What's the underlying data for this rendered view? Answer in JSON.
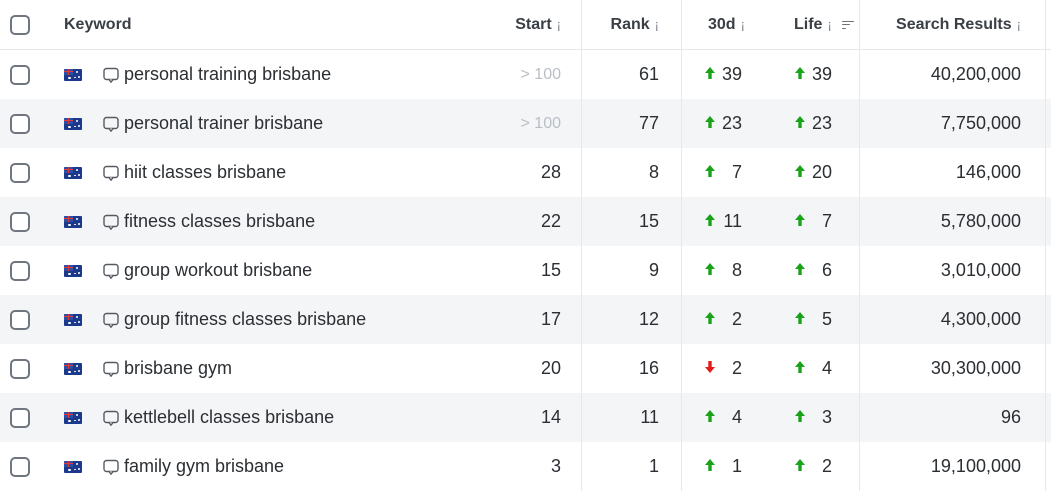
{
  "colors": {
    "up": "#1aa319",
    "down": "#e21b1b",
    "row_alt": "#f4f5f7",
    "muted_text": "#b9bec5"
  },
  "header": {
    "keyword": "Keyword",
    "start": "Start",
    "rank": "Rank",
    "d30": "30d",
    "life": "Life",
    "search_results": "Search Results",
    "info_glyph": "¡"
  },
  "rows": [
    {
      "keyword": "personal training brisbane",
      "start": "> 100",
      "start_muted": true,
      "rank": "61",
      "d30": "39",
      "d30_dir": "up",
      "life": "39",
      "life_dir": "up",
      "search_results": "40,200,000",
      "flag_icon": "australia-flag-icon",
      "serp_icon": "serp-preview-icon"
    },
    {
      "keyword": "personal trainer brisbane",
      "start": "> 100",
      "start_muted": true,
      "rank": "77",
      "d30": "23",
      "d30_dir": "up",
      "life": "23",
      "life_dir": "up",
      "search_results": "7,750,000",
      "flag_icon": "australia-flag-icon",
      "serp_icon": "serp-preview-icon"
    },
    {
      "keyword": "hiit classes brisbane",
      "start": "28",
      "start_muted": false,
      "rank": "8",
      "d30": "7",
      "d30_dir": "up",
      "life": "20",
      "life_dir": "up",
      "search_results": "146,000",
      "flag_icon": "australia-flag-icon",
      "serp_icon": "serp-preview-icon"
    },
    {
      "keyword": "fitness classes brisbane",
      "start": "22",
      "start_muted": false,
      "rank": "15",
      "d30": "11",
      "d30_dir": "up",
      "life": "7",
      "life_dir": "up",
      "search_results": "5,780,000",
      "flag_icon": "australia-flag-icon",
      "serp_icon": "serp-preview-icon"
    },
    {
      "keyword": "group workout brisbane",
      "start": "15",
      "start_muted": false,
      "rank": "9",
      "d30": "8",
      "d30_dir": "up",
      "life": "6",
      "life_dir": "up",
      "search_results": "3,010,000",
      "flag_icon": "australia-flag-icon",
      "serp_icon": "serp-preview-icon"
    },
    {
      "keyword": "group fitness classes brisbane",
      "start": "17",
      "start_muted": false,
      "rank": "12",
      "d30": "2",
      "d30_dir": "up",
      "life": "5",
      "life_dir": "up",
      "search_results": "4,300,000",
      "flag_icon": "australia-flag-icon",
      "serp_icon": "serp-preview-icon"
    },
    {
      "keyword": "brisbane gym",
      "start": "20",
      "start_muted": false,
      "rank": "16",
      "d30": "2",
      "d30_dir": "down",
      "life": "4",
      "life_dir": "up",
      "search_results": "30,300,000",
      "flag_icon": "australia-flag-icon",
      "serp_icon": "serp-preview-icon"
    },
    {
      "keyword": "kettlebell classes brisbane",
      "start": "14",
      "start_muted": false,
      "rank": "11",
      "d30": "4",
      "d30_dir": "up",
      "life": "3",
      "life_dir": "up",
      "search_results": "96",
      "flag_icon": "australia-flag-icon",
      "serp_icon": "serp-preview-icon"
    },
    {
      "keyword": "family gym brisbane",
      "start": "3",
      "start_muted": false,
      "rank": "1",
      "d30": "1",
      "d30_dir": "up",
      "life": "2",
      "life_dir": "up",
      "search_results": "19,100,000",
      "flag_icon": "australia-flag-icon",
      "serp_icon": "serp-preview-icon"
    }
  ]
}
